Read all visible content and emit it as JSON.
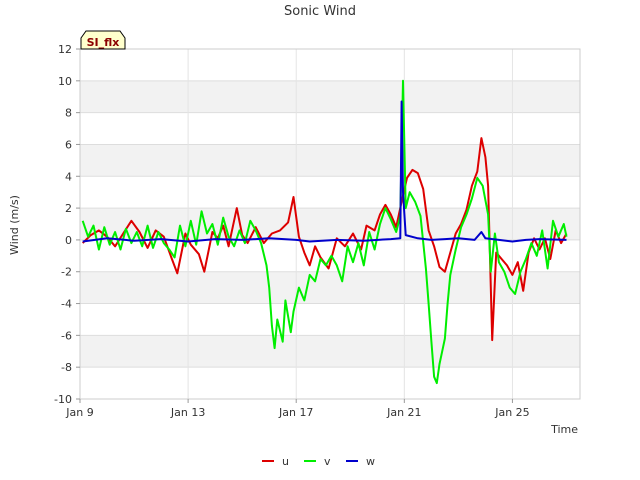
{
  "chart_data": {
    "type": "line",
    "title": "Sonic Wind",
    "xlabel": "Time",
    "ylabel": "Wind (m/s)",
    "badge": "SI_flx",
    "xlim": [
      9.0,
      27.5
    ],
    "ylim": [
      -10,
      12
    ],
    "yticks": [
      -10,
      -8,
      -6,
      -4,
      -2,
      0,
      2,
      4,
      6,
      8,
      10,
      12
    ],
    "xticks": [
      {
        "value": 9,
        "label": "Jan 9"
      },
      {
        "value": 13,
        "label": "Jan 13"
      },
      {
        "value": 17,
        "label": "Jan 17"
      },
      {
        "value": 21,
        "label": "Jan 21"
      },
      {
        "value": 25,
        "label": "Jan 25"
      }
    ],
    "legend_position": "bottom-center",
    "series": [
      {
        "name": "u",
        "color": "#dd0000",
        "points": [
          [
            9.1,
            -0.2
          ],
          [
            9.4,
            0.3
          ],
          [
            9.7,
            0.6
          ],
          [
            10.0,
            0.2
          ],
          [
            10.3,
            -0.4
          ],
          [
            10.6,
            0.4
          ],
          [
            10.9,
            1.2
          ],
          [
            11.2,
            0.5
          ],
          [
            11.5,
            -0.5
          ],
          [
            11.8,
            0.6
          ],
          [
            12.1,
            0.2
          ],
          [
            12.4,
            -1.2
          ],
          [
            12.6,
            -2.1
          ],
          [
            12.9,
            0.4
          ],
          [
            13.1,
            -0.3
          ],
          [
            13.4,
            -0.9
          ],
          [
            13.6,
            -2.0
          ],
          [
            13.9,
            0.5
          ],
          [
            14.1,
            0.1
          ],
          [
            14.3,
            0.9
          ],
          [
            14.5,
            -0.4
          ],
          [
            14.8,
            2.0
          ],
          [
            15.0,
            0.3
          ],
          [
            15.2,
            -0.2
          ],
          [
            15.5,
            0.8
          ],
          [
            15.8,
            -0.2
          ],
          [
            16.1,
            0.4
          ],
          [
            16.4,
            0.6
          ],
          [
            16.7,
            1.1
          ],
          [
            16.9,
            2.7
          ],
          [
            17.1,
            0.2
          ],
          [
            17.3,
            -0.8
          ],
          [
            17.5,
            -1.6
          ],
          [
            17.7,
            -0.4
          ],
          [
            17.9,
            -1.1
          ],
          [
            18.2,
            -1.8
          ],
          [
            18.5,
            0.1
          ],
          [
            18.8,
            -0.4
          ],
          [
            19.1,
            0.4
          ],
          [
            19.4,
            -0.6
          ],
          [
            19.6,
            0.9
          ],
          [
            19.9,
            0.6
          ],
          [
            20.1,
            1.6
          ],
          [
            20.3,
            2.2
          ],
          [
            20.5,
            1.6
          ],
          [
            20.7,
            0.8
          ],
          [
            20.9,
            2.4
          ],
          [
            21.1,
            3.9
          ],
          [
            21.3,
            4.4
          ],
          [
            21.5,
            4.2
          ],
          [
            21.7,
            3.2
          ],
          [
            21.9,
            0.6
          ],
          [
            22.1,
            -0.4
          ],
          [
            22.3,
            -1.7
          ],
          [
            22.5,
            -2.0
          ],
          [
            22.7,
            -0.8
          ],
          [
            22.9,
            0.4
          ],
          [
            23.1,
            1.0
          ],
          [
            23.3,
            1.9
          ],
          [
            23.5,
            3.4
          ],
          [
            23.7,
            4.3
          ],
          [
            23.85,
            6.4
          ],
          [
            24.0,
            5.2
          ],
          [
            24.1,
            3.4
          ],
          [
            24.25,
            -6.3
          ],
          [
            24.4,
            -0.8
          ],
          [
            24.6,
            -1.2
          ],
          [
            24.8,
            -1.6
          ],
          [
            25.0,
            -2.2
          ],
          [
            25.2,
            -1.4
          ],
          [
            25.4,
            -3.2
          ],
          [
            25.6,
            -0.8
          ],
          [
            25.8,
            0.1
          ],
          [
            26.0,
            -0.6
          ],
          [
            26.2,
            0.1
          ],
          [
            26.4,
            -1.2
          ],
          [
            26.6,
            0.6
          ],
          [
            26.8,
            -0.2
          ],
          [
            27.0,
            0.4
          ]
        ]
      },
      {
        "name": "v",
        "color": "#00ee00",
        "points": [
          [
            9.1,
            1.2
          ],
          [
            9.3,
            0.2
          ],
          [
            9.5,
            0.9
          ],
          [
            9.7,
            -0.6
          ],
          [
            9.9,
            0.8
          ],
          [
            10.1,
            -0.3
          ],
          [
            10.3,
            0.5
          ],
          [
            10.5,
            -0.6
          ],
          [
            10.7,
            0.7
          ],
          [
            10.9,
            -0.2
          ],
          [
            11.1,
            0.5
          ],
          [
            11.3,
            -0.4
          ],
          [
            11.5,
            0.9
          ],
          [
            11.7,
            -0.5
          ],
          [
            11.9,
            0.5
          ],
          [
            12.1,
            -0.2
          ],
          [
            12.3,
            -0.6
          ],
          [
            12.5,
            -1.1
          ],
          [
            12.7,
            0.9
          ],
          [
            12.9,
            -0.4
          ],
          [
            13.1,
            1.2
          ],
          [
            13.3,
            -0.3
          ],
          [
            13.5,
            1.8
          ],
          [
            13.7,
            0.4
          ],
          [
            13.9,
            1.0
          ],
          [
            14.1,
            -0.3
          ],
          [
            14.3,
            1.4
          ],
          [
            14.5,
            0.2
          ],
          [
            14.7,
            -0.4
          ],
          [
            14.9,
            0.6
          ],
          [
            15.1,
            -0.2
          ],
          [
            15.3,
            1.2
          ],
          [
            15.5,
            0.6
          ],
          [
            15.7,
            -0.2
          ],
          [
            15.9,
            -1.6
          ],
          [
            16.0,
            -3.0
          ],
          [
            16.1,
            -5.4
          ],
          [
            16.2,
            -6.8
          ],
          [
            16.3,
            -5.0
          ],
          [
            16.5,
            -6.4
          ],
          [
            16.6,
            -3.8
          ],
          [
            16.8,
            -5.8
          ],
          [
            16.9,
            -4.5
          ],
          [
            17.1,
            -3.0
          ],
          [
            17.3,
            -3.8
          ],
          [
            17.5,
            -2.2
          ],
          [
            17.7,
            -2.6
          ],
          [
            17.9,
            -1.2
          ],
          [
            18.1,
            -1.6
          ],
          [
            18.3,
            -1.0
          ],
          [
            18.5,
            -1.6
          ],
          [
            18.7,
            -2.6
          ],
          [
            18.9,
            -0.4
          ],
          [
            19.1,
            -1.4
          ],
          [
            19.3,
            -0.2
          ],
          [
            19.5,
            -1.6
          ],
          [
            19.7,
            0.5
          ],
          [
            19.9,
            -0.6
          ],
          [
            20.1,
            1.0
          ],
          [
            20.3,
            2.0
          ],
          [
            20.5,
            1.3
          ],
          [
            20.7,
            0.5
          ],
          [
            20.85,
            1.5
          ],
          [
            20.95,
            10.0
          ],
          [
            21.05,
            2.0
          ],
          [
            21.2,
            3.0
          ],
          [
            21.4,
            2.4
          ],
          [
            21.6,
            1.5
          ],
          [
            21.8,
            -1.8
          ],
          [
            21.9,
            -4.0
          ],
          [
            22.0,
            -6.4
          ],
          [
            22.1,
            -8.6
          ],
          [
            22.2,
            -9.0
          ],
          [
            22.3,
            -7.8
          ],
          [
            22.4,
            -7.0
          ],
          [
            22.5,
            -6.2
          ],
          [
            22.6,
            -4.0
          ],
          [
            22.7,
            -2.2
          ],
          [
            22.9,
            -0.6
          ],
          [
            23.1,
            0.8
          ],
          [
            23.3,
            1.6
          ],
          [
            23.5,
            2.6
          ],
          [
            23.7,
            3.9
          ],
          [
            23.9,
            3.4
          ],
          [
            24.1,
            1.6
          ],
          [
            24.2,
            -2.0
          ],
          [
            24.35,
            0.4
          ],
          [
            24.5,
            -1.4
          ],
          [
            24.7,
            -2.0
          ],
          [
            24.9,
            -3.0
          ],
          [
            25.1,
            -3.4
          ],
          [
            25.3,
            -2.0
          ],
          [
            25.5,
            -1.2
          ],
          [
            25.7,
            -0.2
          ],
          [
            25.9,
            -1.0
          ],
          [
            26.1,
            0.6
          ],
          [
            26.3,
            -1.8
          ],
          [
            26.5,
            1.2
          ],
          [
            26.7,
            0.2
          ],
          [
            26.9,
            1.0
          ],
          [
            27.0,
            0.2
          ]
        ]
      },
      {
        "name": "w",
        "color": "#0000cc",
        "points": [
          [
            9.1,
            -0.1
          ],
          [
            10.0,
            0.1
          ],
          [
            11.0,
            -0.05
          ],
          [
            12.0,
            0.05
          ],
          [
            13.0,
            -0.1
          ],
          [
            14.0,
            0.05
          ],
          [
            15.0,
            0.0
          ],
          [
            16.0,
            0.1
          ],
          [
            17.0,
            0.0
          ],
          [
            17.5,
            -0.1
          ],
          [
            18.5,
            0.0
          ],
          [
            19.5,
            -0.05
          ],
          [
            20.5,
            0.05
          ],
          [
            20.85,
            0.1
          ],
          [
            20.9,
            8.7
          ],
          [
            20.95,
            3.0
          ],
          [
            21.05,
            0.3
          ],
          [
            21.5,
            0.1
          ],
          [
            22.0,
            0.0
          ],
          [
            22.5,
            0.05
          ],
          [
            23.0,
            0.1
          ],
          [
            23.6,
            0.0
          ],
          [
            23.85,
            0.5
          ],
          [
            24.0,
            0.1
          ],
          [
            24.5,
            0.0
          ],
          [
            25.0,
            -0.1
          ],
          [
            25.5,
            0.0
          ],
          [
            26.0,
            0.05
          ],
          [
            27.0,
            0.0
          ]
        ]
      }
    ]
  }
}
